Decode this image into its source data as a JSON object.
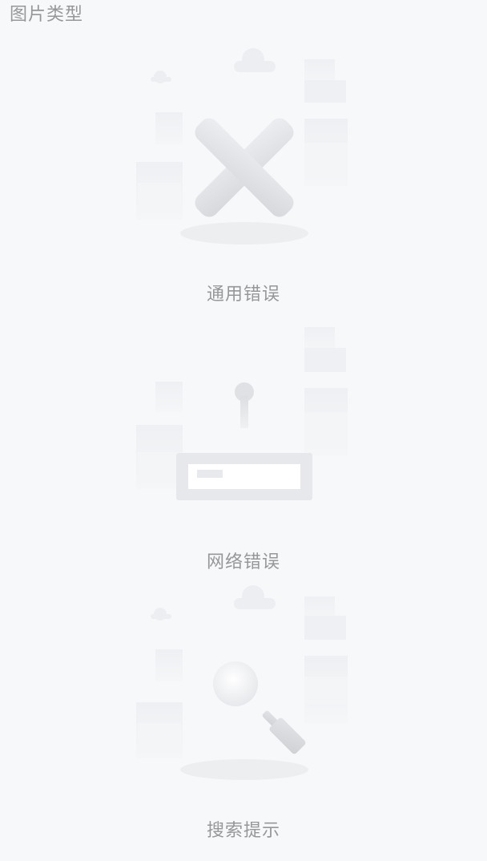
{
  "page": {
    "title": "图片类型"
  },
  "empty_states": [
    {
      "type": "error",
      "icon": "error-cross-icon",
      "description": "通用错误"
    },
    {
      "type": "network",
      "icon": "network-error-icon",
      "description": "网络错误"
    },
    {
      "type": "search",
      "icon": "search-empty-icon",
      "description": "搜索提示"
    }
  ],
  "colors": {
    "background": "#f7f8fa",
    "text_secondary": "#969799",
    "illustration_gray": "#dcdee0"
  }
}
